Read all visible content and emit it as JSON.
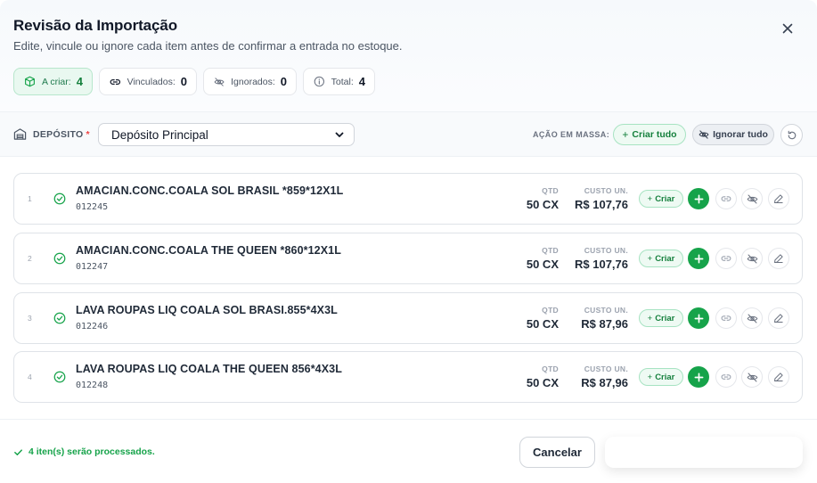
{
  "header": {
    "title": "Revisão da Importação",
    "subtitle": "Edite, vincule ou ignore cada item antes de confirmar a entrada no estoque."
  },
  "stats": [
    {
      "label": "A criar:",
      "value": "4",
      "icon": "box-icon"
    },
    {
      "label": "Vinculados:",
      "value": "0",
      "icon": "link-icon"
    },
    {
      "label": "Ignorados:",
      "value": "0",
      "icon": "eye-off-icon"
    },
    {
      "label": "Total:",
      "value": "4",
      "icon": "info-icon"
    }
  ],
  "toolbar": {
    "deposito_label": "DEPÓSITO",
    "required_mark": "*",
    "deposito_value": "Depósito Principal",
    "mass_action_label": "AÇÃO EM MASSA:",
    "criar_tudo": "Criar tudo",
    "ignorar_tudo": "Ignorar tudo"
  },
  "items": [
    {
      "index": "1",
      "name": "AMACIAN.CONC.COALA SOL BRASIL *859*12X1L",
      "code": "012245",
      "qtd_label": "QTD",
      "qtd": "50 CX",
      "custo_label": "CUSTO UN.",
      "custo": "R$ 107,76",
      "action": "Criar"
    },
    {
      "index": "2",
      "name": "AMACIAN.CONC.COALA THE QUEEN *860*12X1L",
      "code": "012247",
      "qtd_label": "QTD",
      "qtd": "50 CX",
      "custo_label": "CUSTO UN.",
      "custo": "R$ 107,76",
      "action": "Criar"
    },
    {
      "index": "3",
      "name": "LAVA ROUPAS LIQ COALA SOL BRASI.855*4X3L",
      "code": "012246",
      "qtd_label": "QTD",
      "qtd": "50 CX",
      "custo_label": "CUSTO UN.",
      "custo": "R$ 87,96",
      "action": "Criar"
    },
    {
      "index": "4",
      "name": "LAVA ROUPAS LIQ COALA THE QUEEN 856*4X3L",
      "code": "012248",
      "qtd_label": "QTD",
      "qtd": "50 CX",
      "custo_label": "CUSTO UN.",
      "custo": "R$ 87,96",
      "action": "Criar"
    }
  ],
  "footer": {
    "message": "4 iten(s) serão processados.",
    "cancel": "Cancelar"
  },
  "colors": {
    "accent_green": "#16a34a",
    "active_chip_bg": "#e9f8f0",
    "required_red": "#ef4444"
  }
}
